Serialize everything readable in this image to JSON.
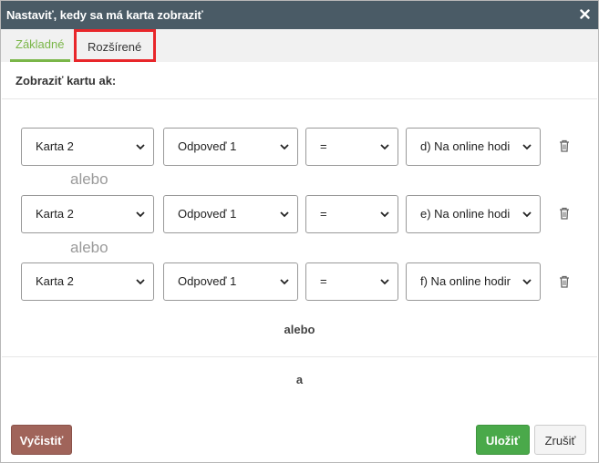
{
  "dialog": {
    "title": "Nastaviť, kedy sa má karta zobraziť",
    "close_icon": "close-icon"
  },
  "tabs": [
    {
      "label": "Základné",
      "active": true
    },
    {
      "label": "Rozšírené",
      "active": false,
      "highlighted": true
    }
  ],
  "section_title": "Zobraziť kartu ak:",
  "conditions": [
    {
      "card": "Karta 2",
      "answer": "Odpoveď 1",
      "operator": "=",
      "value": "d) Na online hodi"
    },
    {
      "card": "Karta 2",
      "answer": "Odpoveď 1",
      "operator": "=",
      "value": "e) Na online hodi"
    },
    {
      "card": "Karta 2",
      "answer": "Odpoveď 1",
      "operator": "=",
      "value": "f) Na online hodir"
    }
  ],
  "or_separator": "alebo",
  "or_group_label": "alebo",
  "and_group_label": "a",
  "buttons": {
    "clear": "Vyčistiť",
    "save": "Uložiť",
    "cancel": "Zrušiť"
  },
  "colors": {
    "titlebar": "#4a5b66",
    "active_tab": "#7ab648",
    "highlight": "#e8262a",
    "clear": "#a0645a",
    "save": "#4aa94a"
  }
}
